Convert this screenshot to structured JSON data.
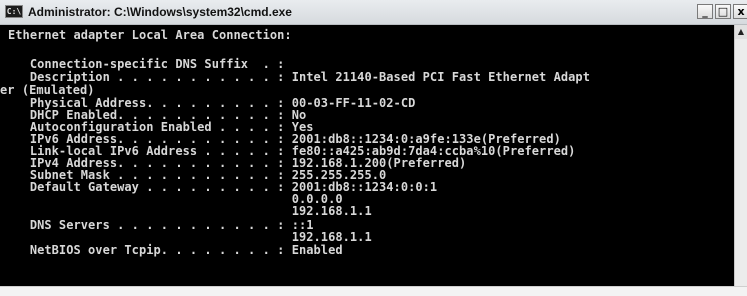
{
  "window": {
    "title": "Administrator: C:\\Windows\\system32\\cmd.exe",
    "icon_glyph": "C:\\",
    "buttons": {
      "minimize": "_",
      "maximize": "□",
      "close": "x"
    }
  },
  "console": {
    "lines": [
      "Ethernet adapter Local Area Connection:",
      "",
      "   Connection-specific DNS Suffix  . :",
      "   Description . . . . . . . . . . . : Intel 21140-Based PCI Fast Ethernet Adapt",
      "er (Emulated)",
      "   Physical Address. . . . . . . . . : 00-03-FF-11-02-CD",
      "   DHCP Enabled. . . . . . . . . . . : No",
      "   Autoconfiguration Enabled . . . . : Yes",
      "   IPv6 Address. . . . . . . . . . . : 2001:db8::1234:0:a9fe:133e(Preferred)",
      "   Link-local IPv6 Address . . . . . : fe80::a425:ab9d:7da4:ccba%10(Preferred)",
      "   IPv4 Address. . . . . . . . . . . : 192.168.1.200(Preferred)",
      "   Subnet Mask . . . . . . . . . . . : 255.255.255.0",
      "   Default Gateway . . . . . . . . . : 2001:db8::1234:0:0:1",
      "                                       0.0.0.0",
      "                                       192.168.1.1",
      "   DNS Servers . . . . . . . . . . . : ::1",
      "                                       192.168.1.1",
      "   NetBIOS over Tcpip. . . . . . . . : Enabled"
    ]
  },
  "scrollbar": {
    "up_arrow_glyph": "▲"
  }
}
